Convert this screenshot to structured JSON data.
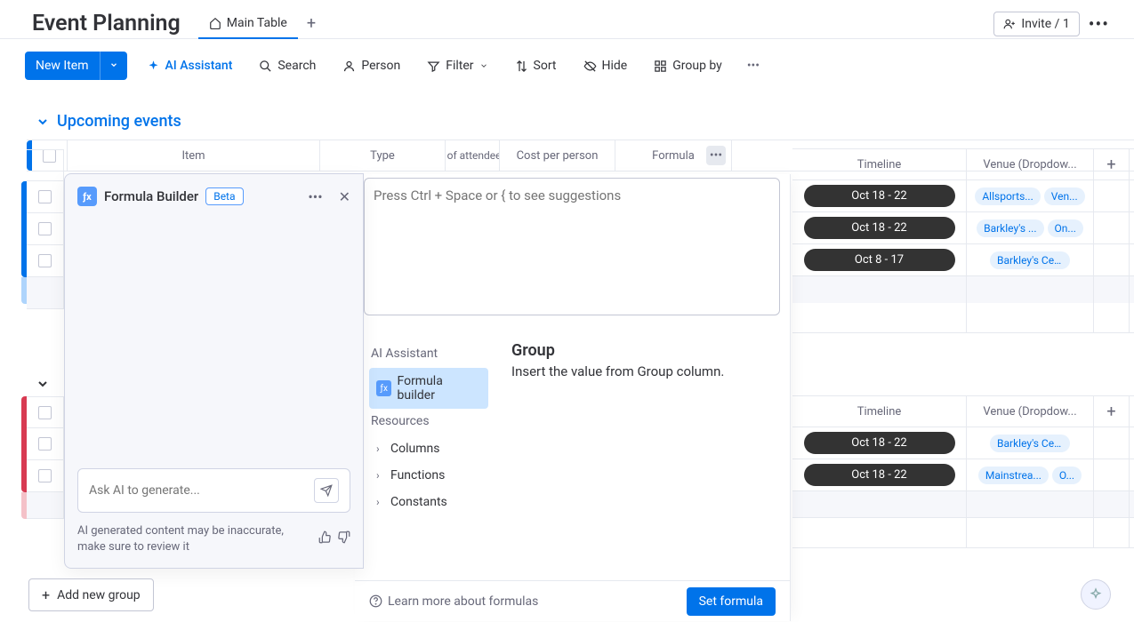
{
  "header": {
    "title": "Event Planning",
    "tab_label": "Main Table",
    "invite_label": "Invite / 1"
  },
  "toolbar": {
    "new_item": "New Item",
    "ai_assistant": "AI Assistant",
    "search": "Search",
    "person": "Person",
    "filter": "Filter",
    "sort": "Sort",
    "hide": "Hide",
    "group_by": "Group by"
  },
  "group1": {
    "title": "Upcoming events"
  },
  "columns": {
    "item": "Item",
    "type": "Type",
    "attendees": "# of attendees",
    "cost": "Cost per person",
    "formula": "Formula",
    "timeline": "Timeline",
    "venue": "Venue (Dropdow..."
  },
  "rows_right_g1": [
    {
      "timeline": "Oct 18 - 22",
      "venues": [
        "Allsports...",
        "Ven..."
      ]
    },
    {
      "timeline": "Oct 18 - 22",
      "venues": [
        "Barkley's ...",
        "On..."
      ]
    },
    {
      "timeline": "Oct 8 - 17",
      "venues": [
        "Barkley's Center"
      ]
    }
  ],
  "rows_right_g2": [
    {
      "timeline": "Oct 18 - 22",
      "venues": [
        "Barkley's Center"
      ]
    },
    {
      "timeline": "Oct 18 - 22",
      "venues": [
        "Mainstrea...",
        "O..."
      ]
    }
  ],
  "formula_builder": {
    "title": "Formula Builder",
    "badge": "Beta",
    "input_placeholder": "Ask AI to generate...",
    "disclaimer": "AI generated content may be inaccurate, make sure to review it"
  },
  "formula_editor": {
    "placeholder": "Press Ctrl + Space or { to see suggestions",
    "left_section1": "AI Assistant",
    "left_item_active": "Formula builder",
    "left_section2": "Resources",
    "left_columns": "Columns",
    "left_functions": "Functions",
    "left_constants": "Constants",
    "right_title": "Group",
    "right_desc": "Insert the value from Group column.",
    "learn_more": "Learn more about formulas",
    "set_formula": "Set formula"
  },
  "add_group": "Add new group"
}
